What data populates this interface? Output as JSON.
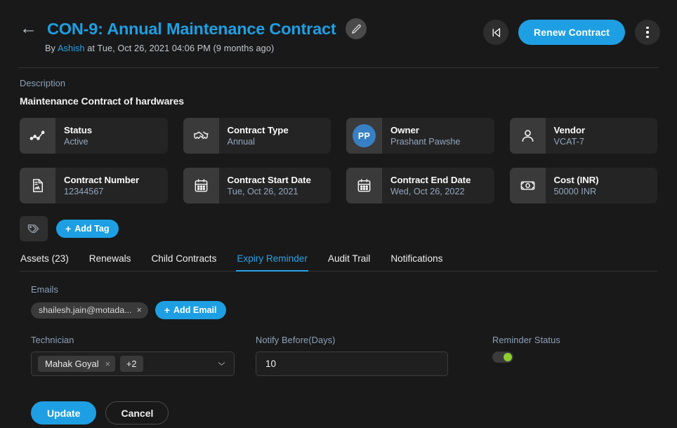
{
  "header": {
    "back_icon": "arrow-left-icon",
    "title": "CON-9: Annual Maintenance Contract",
    "edit_icon": "pencil-icon",
    "byline_prefix": "By",
    "byline_user": "Ashish",
    "byline_suffix": "at Tue, Oct 26, 2021 04:06 PM (9 months ago)",
    "prev_icon": "skip-back-icon",
    "renew_label": "Renew Contract",
    "more_icon": "kebab-menu-icon"
  },
  "description": {
    "label": "Description",
    "value": "Maintenance Contract of hardwares"
  },
  "cards": [
    {
      "icon": "activity-chart-icon",
      "label": "Status",
      "value": "Active"
    },
    {
      "icon": "handshake-icon",
      "label": "Contract Type",
      "value": "Annual"
    },
    {
      "icon": "avatar-initials",
      "initials": "PP",
      "label": "Owner",
      "value": "Prashant Pawshe"
    },
    {
      "icon": "user-icon",
      "label": "Vendor",
      "value": "VCAT-7"
    },
    {
      "icon": "document-icon",
      "label": "Contract Number",
      "value": "12344567"
    },
    {
      "icon": "calendar-icon",
      "label": "Contract Start Date",
      "value": "Tue, Oct 26, 2021"
    },
    {
      "icon": "calendar-icon",
      "label": "Contract End Date",
      "value": "Wed, Oct 26, 2022"
    },
    {
      "icon": "money-icon",
      "label": "Cost (INR)",
      "value": "50000 INR"
    }
  ],
  "tags": {
    "icon": "tags-icon",
    "add_label": "Add Tag",
    "plus": "+"
  },
  "tabs": [
    {
      "label": "Assets (23)",
      "active": false
    },
    {
      "label": "Renewals",
      "active": false
    },
    {
      "label": "Child Contracts",
      "active": false
    },
    {
      "label": "Expiry Reminder",
      "active": true
    },
    {
      "label": "Audit Trail",
      "active": false
    },
    {
      "label": "Notifications",
      "active": false
    }
  ],
  "form": {
    "emails_label": "Emails",
    "email_chip": "shailesh.jain@motada...",
    "email_chip_close": "×",
    "add_email_label": "Add Email",
    "add_email_plus": "+",
    "technician_label": "Technician",
    "technician_chip": "Mahak Goyal",
    "technician_chip_close": "×",
    "technician_more": "+2",
    "notify_label": "Notify Before(Days)",
    "notify_value": "10",
    "notify_placeholder": "Notify Before(Days)",
    "reminder_label": "Reminder Status",
    "reminder_on": true,
    "update_label": "Update",
    "cancel_label": "Cancel"
  },
  "colors": {
    "accent": "#1e9fe3",
    "background": "#191919",
    "card": "#242424",
    "card_icon": "#3a3a3a",
    "muted_text": "#8ea2bb",
    "toggle_on": "#8ccf2f",
    "avatar": "#3880c4"
  }
}
